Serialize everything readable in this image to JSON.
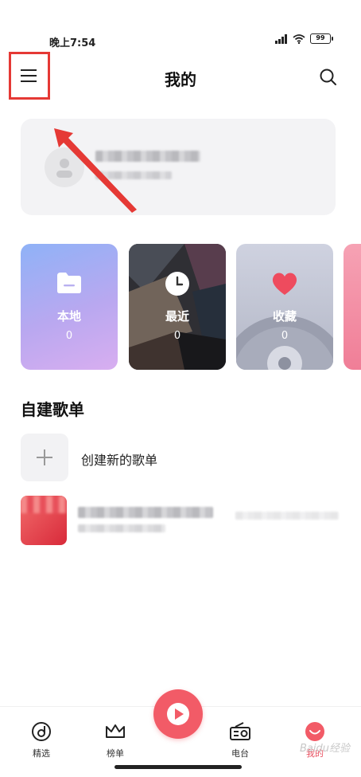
{
  "status_bar": {
    "time": "晚上7:54",
    "battery": "99"
  },
  "header": {
    "title": "我的",
    "menu_icon": "hamburger-menu-icon",
    "search_icon": "search-icon"
  },
  "colors": {
    "accent": "#f25b67",
    "highlight_box": "#e53935",
    "arrow": "#e53935"
  },
  "cards": [
    {
      "label": "本地",
      "count": "0",
      "icon": "folder-icon"
    },
    {
      "label": "最近",
      "count": "0",
      "icon": "clock-icon"
    },
    {
      "label": "收藏",
      "count": "0",
      "icon": "heart-icon"
    }
  ],
  "playlists": {
    "section_title": "自建歌单",
    "create_label": "创建新的歌单"
  },
  "bottom_nav": [
    {
      "label": "精选",
      "icon": "disc-icon"
    },
    {
      "label": "榜单",
      "icon": "crown-icon"
    },
    {
      "label": "",
      "icon": "play-icon"
    },
    {
      "label": "电台",
      "icon": "radio-icon"
    },
    {
      "label": "我的",
      "icon": "smile-icon",
      "active": true
    }
  ],
  "watermark": "Baidu经验"
}
